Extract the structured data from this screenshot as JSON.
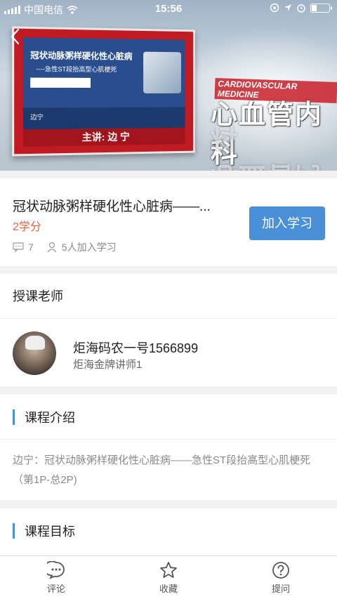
{
  "status_bar": {
    "carrier": "中国电信",
    "time": "15:56",
    "battery_level": 0.3
  },
  "hero": {
    "slide_title": "冠状动脉粥样硬化性心脏病",
    "slide_subtitle": "----急性ST段抬高型心肌梗死",
    "slide_logo_text": "",
    "slide_lecturer_small": "边宁",
    "slide_dept_small": "",
    "lecturer_band": "主讲: 边 宁",
    "department_en": "CARDIOVASCULAR MEDICINE",
    "department_cn": "心血管内科"
  },
  "course": {
    "title": "冠状动脉粥样硬化性心脏病——...",
    "credits": "2学分",
    "comments": "7",
    "enrolled": "5人加入学习",
    "join_label": "加入学习"
  },
  "teacher_section": {
    "heading": "授课老师",
    "name": "炬海码农一号1566899",
    "title": "炬海金牌讲师1"
  },
  "intro_section": {
    "heading": "课程介绍",
    "text": "边宁：冠状动脉粥样硬化性心脏病——急性ST段抬高型心肌梗死（第1P-总2P)"
  },
  "goal_section": {
    "heading": "课程目标"
  },
  "tabbar": {
    "items": [
      {
        "label": "评论",
        "icon": "comment-icon"
      },
      {
        "label": "收藏",
        "icon": "star-icon"
      },
      {
        "label": "提问",
        "icon": "question-icon"
      }
    ]
  },
  "colors": {
    "accent": "#4a90d9",
    "credits": "#e8643c",
    "hero_red": "#c21a22"
  }
}
